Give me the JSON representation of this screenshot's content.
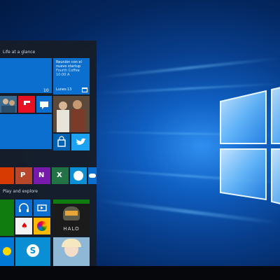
{
  "start_menu": {
    "group1_label": "Life at a glance",
    "group2_label": "Play and explore",
    "calendar_tile": {
      "text1": "Reunión con el",
      "text2": "nuevo startup",
      "text3": "Fourth Coffee",
      "text4": "10:00 A",
      "day_name": "Lunes",
      "day_number": "13"
    },
    "small_number": "10"
  },
  "colors": {
    "tile_blue": "#0a6fcf",
    "tile_dark_blue": "#0063b1",
    "accent": "#0078d7"
  }
}
